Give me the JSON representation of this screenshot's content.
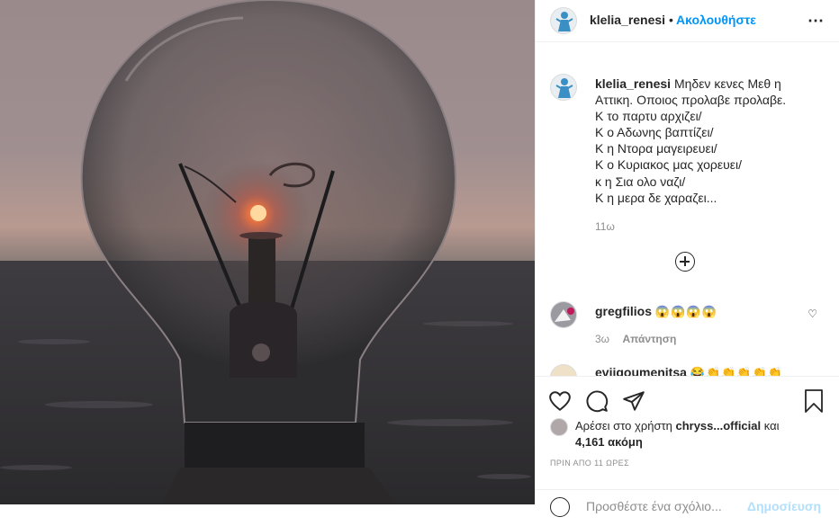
{
  "post": {
    "username": "klelia_renesi",
    "follow_label": "Ακολουθήστε",
    "dot": "•",
    "more_icon": "⋯"
  },
  "caption": {
    "username": "klelia_renesi",
    "lines": [
      "Μηδεν κενες Μεθ η",
      "Αττικη. Οποιος προλαβε προλαβε.",
      "Κ το παρτυ αρχιζει/",
      "Κ ο Αδωνης βαπτίζει/",
      "Κ η Ντορα μαγειρευει/",
      "Κ ο Κυριακος μας χορευει/",
      "κ η Σια ολο ναζι/",
      "Κ η μερα δε χαραζει..."
    ],
    "time": "11ω"
  },
  "comments": [
    {
      "username": "gregfilios",
      "text": "😱😱😱😱",
      "time": "3ω",
      "reply_label": "Απάντηση"
    },
    {
      "username": "eviigoumenitsa",
      "text": "😂👏👏👏👏👏",
      "time": "",
      "reply_label": ""
    }
  ],
  "likes": {
    "prefix": "Αρέσει στο χρήστη",
    "name": "chryss...official",
    "conj": "και",
    "count": "4,161 ακόμη"
  },
  "posted_ago": "ΠΡΙΝ ΑΠΟ 11 ΩΡΕΣ",
  "add_comment": {
    "placeholder": "Προσθέστε ένα σχόλιο...",
    "post_label": "Δημοσίευση"
  },
  "colors": {
    "accent": "#0095f6",
    "text": "#262626",
    "muted": "#8e8e8e",
    "filament_glow": "#ff5a2a"
  }
}
